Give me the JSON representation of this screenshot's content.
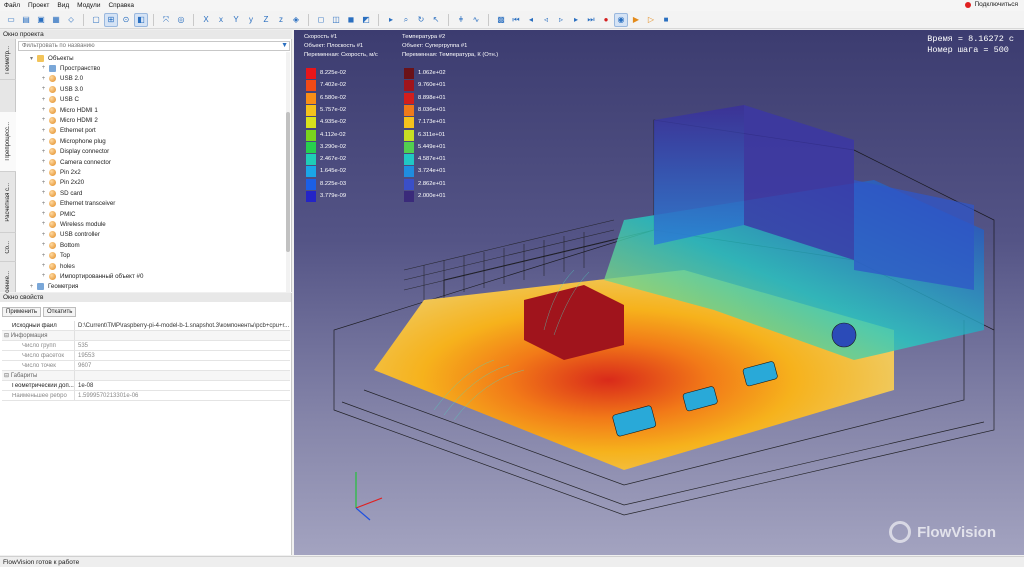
{
  "menu": [
    "Файл",
    "Проект",
    "Вид",
    "Модули",
    "Справка"
  ],
  "connect_label": "Подключиться",
  "toolbar_icons": [
    "new-icon",
    "open-icon",
    "save-icon",
    "saveas-icon",
    "export-icon",
    "sep",
    "frame-icon",
    "tree-icon",
    "filter-icon",
    "layer-icon",
    "sep",
    "fit-icon",
    "target-icon",
    "sep",
    "axis-x-icon",
    "axis-neg-x-icon",
    "axis-y-icon",
    "axis-neg-y-icon",
    "axis-z-icon",
    "axis-neg-z-icon",
    "iso-icon",
    "sep",
    "box-icon",
    "wire-icon",
    "solid-icon",
    "section-icon",
    "sep",
    "play-icon",
    "zoom-icon",
    "rotate-icon",
    "pointer-icon",
    "sep",
    "probe-icon",
    "graph-icon",
    "sep",
    "image-icon",
    "first-icon",
    "prev-icon",
    "back-icon",
    "next-icon",
    "fwd-icon",
    "last-icon",
    "record-icon",
    "camera-icon",
    "run-icon",
    "step-icon",
    "stop-icon"
  ],
  "vertical_tabs": [
    "Геометр...",
    "Препроцесс...",
    "Расчетная с...",
    "Со...",
    "Построение..."
  ],
  "project_panel": {
    "title": "Окно проекта",
    "filter_placeholder": "Фильтровать по названию",
    "tree": [
      {
        "label": "Объекты",
        "type": "folder",
        "level": 1,
        "expanded": true
      },
      {
        "label": "Пространство",
        "type": "space",
        "level": 2
      },
      {
        "label": "USB 2.0",
        "type": "obj",
        "level": 2
      },
      {
        "label": "USB 3.0",
        "type": "obj",
        "level": 2
      },
      {
        "label": "USB C",
        "type": "obj",
        "level": 2
      },
      {
        "label": "Micro HDMI 1",
        "type": "obj",
        "level": 2
      },
      {
        "label": "Micro HDMI 2",
        "type": "obj",
        "level": 2
      },
      {
        "label": "Ethernet port",
        "type": "obj",
        "level": 2
      },
      {
        "label": "Microphone plug",
        "type": "obj",
        "level": 2
      },
      {
        "label": "Display connector",
        "type": "obj",
        "level": 2
      },
      {
        "label": "Camera connector",
        "type": "obj",
        "level": 2
      },
      {
        "label": "Pin 2x2",
        "type": "obj",
        "level": 2
      },
      {
        "label": "Pin 2x20",
        "type": "obj",
        "level": 2
      },
      {
        "label": "SD card",
        "type": "obj",
        "level": 2
      },
      {
        "label": "Ethernet transceiver",
        "type": "obj",
        "level": 2
      },
      {
        "label": "PMIC",
        "type": "obj",
        "level": 2
      },
      {
        "label": "Wireless module",
        "type": "obj",
        "level": 2
      },
      {
        "label": "USB controller",
        "type": "obj",
        "level": 2
      },
      {
        "label": "Bottom",
        "type": "obj",
        "level": 2
      },
      {
        "label": "Top",
        "type": "obj",
        "level": 2
      },
      {
        "label": "holes",
        "type": "obj",
        "level": 2
      },
      {
        "label": "Импортированный объект #0",
        "type": "obj",
        "level": 2
      },
      {
        "label": "Геометрия",
        "type": "space",
        "level": 1
      }
    ]
  },
  "properties_panel": {
    "title": "Окно свойств",
    "apply_label": "Применить",
    "revert_label": "Откатить",
    "rows": [
      {
        "key": "Исходный файл",
        "value": "D:\\Current\\TMP\\raspberry-pi-4-model-b-1.snapshot.3\\компоненты\\pcb+cpu+r...",
        "kind": "main"
      },
      {
        "key": "Информация",
        "value": "",
        "kind": "grp"
      },
      {
        "key": "Число групп",
        "value": "535",
        "kind": "sub"
      },
      {
        "key": "Число фасеток",
        "value": "19553",
        "kind": "sub"
      },
      {
        "key": "Число точек",
        "value": "9607",
        "kind": "sub"
      },
      {
        "key": "Габариты",
        "value": "",
        "kind": "grp"
      },
      {
        "key": "Геометрический доп...",
        "value": "1e-08",
        "kind": "main"
      },
      {
        "key": "Наименьшее ребро",
        "value": "1.5999570213301e-06",
        "kind": "dim"
      }
    ]
  },
  "status_text": "FlowVision готов к работе",
  "viewport": {
    "time_label": "Время = 8.16272 с",
    "step_label": "Номер шага = 500",
    "logo_text": "FlowVision",
    "legends": [
      {
        "name": "Скорость #1",
        "object": "Объект: Плоскость #1",
        "variable": "Переменная: Скорость, м/с",
        "values": [
          "8.225e-02",
          "7.402e-02",
          "6.580e-02",
          "5.757e-02",
          "4.935e-02",
          "4.112e-02",
          "3.290e-02",
          "2.467e-02",
          "1.645e-02",
          "8.225e-03",
          "3.779e-09"
        ],
        "colors": [
          "#e8151a",
          "#f04a17",
          "#f98e17",
          "#f5c21c",
          "#d9e21c",
          "#7ad41e",
          "#27cf4e",
          "#1fcdb7",
          "#1aa6e8",
          "#1b5fe6",
          "#2424c6"
        ]
      },
      {
        "name": "Температура #2",
        "object": "Объект: Супергруппа #1",
        "variable": "Переменная: Температура, К (Отн.)",
        "values": [
          "1.062e+02",
          "9.760e+01",
          "8.898e+01",
          "8.036e+01",
          "7.173e+01",
          "6.311e+01",
          "5.449e+01",
          "4.587e+01",
          "3.724e+01",
          "2.862e+01",
          "2.000e+01"
        ],
        "colors": [
          "#6b1218",
          "#a0141c",
          "#d31e1c",
          "#f07a1a",
          "#f5c21c",
          "#c7de23",
          "#52cf50",
          "#20c8c4",
          "#1f8de0",
          "#3a4fc8",
          "#3a2a7a"
        ]
      }
    ]
  }
}
